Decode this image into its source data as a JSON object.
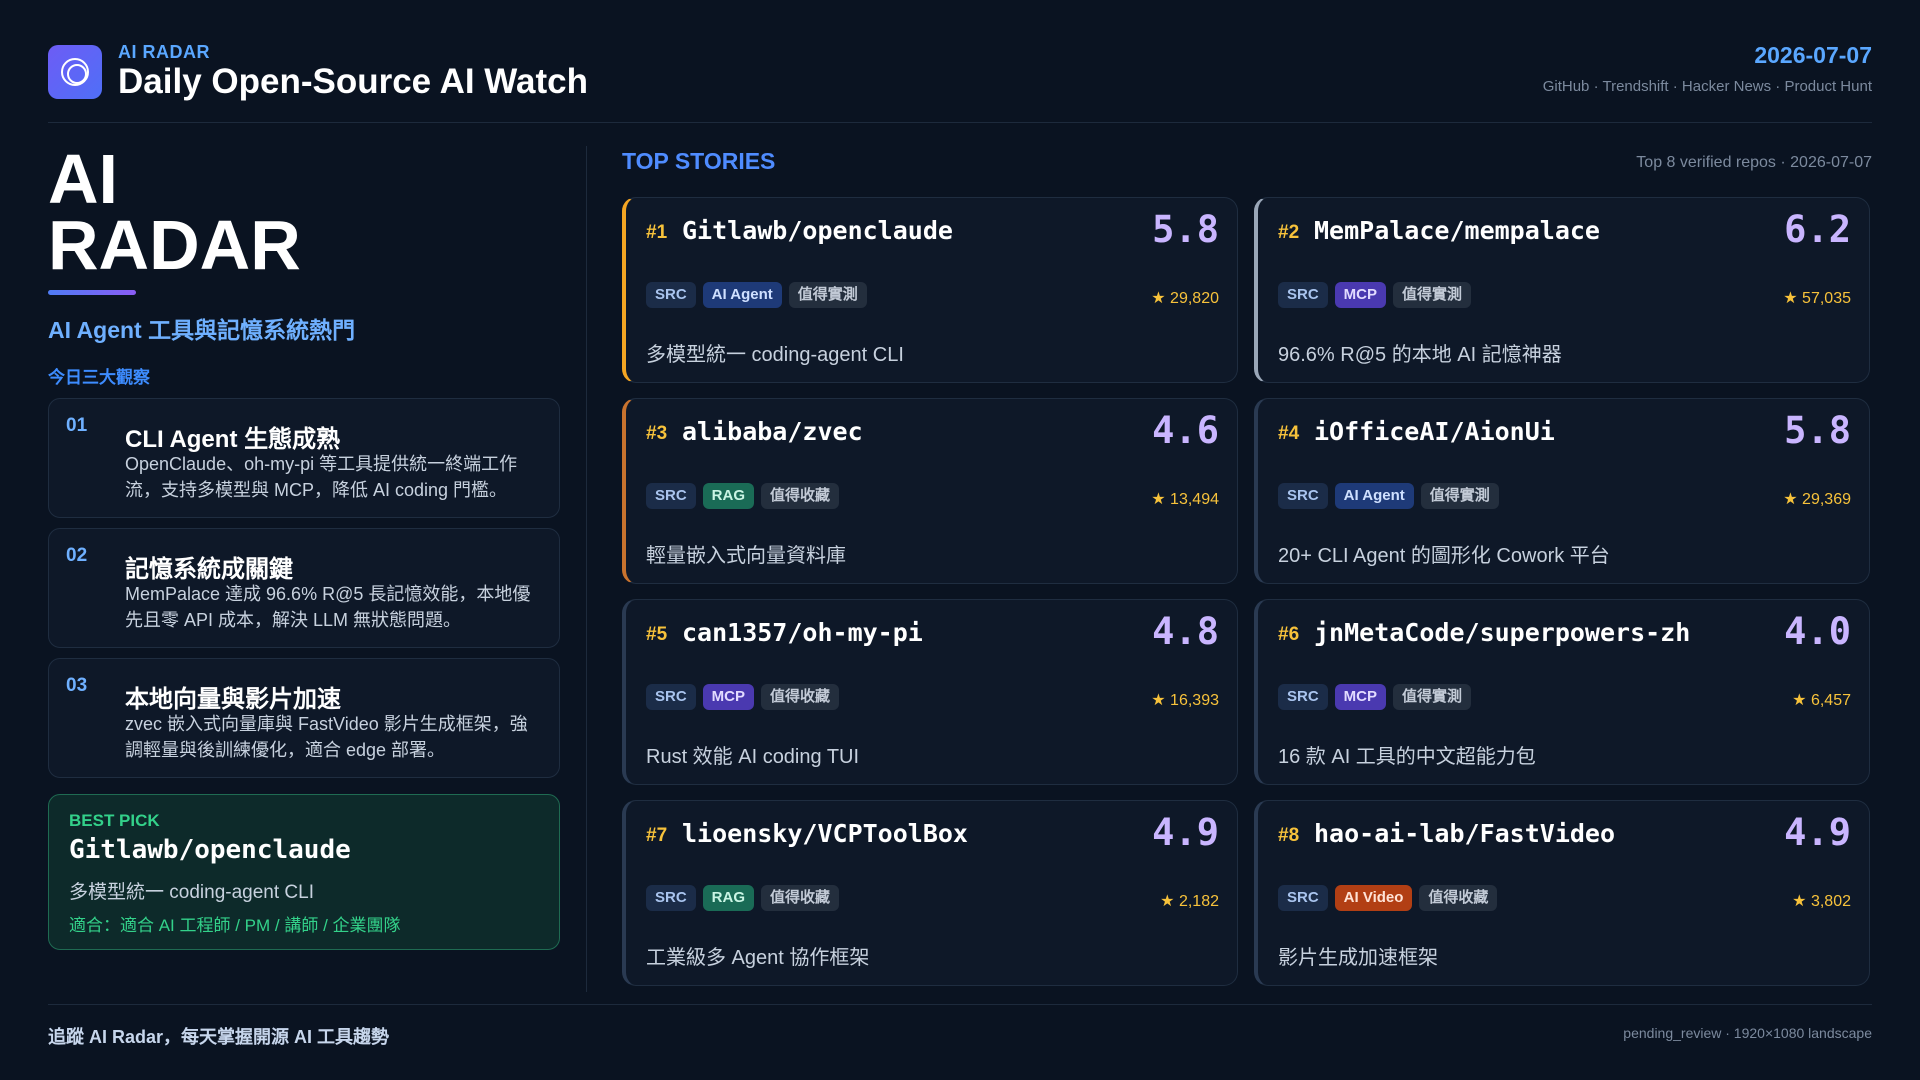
{
  "header": {
    "brand_small": "AI RADAR",
    "title": "Daily Open-Source AI Watch",
    "date": "2026-07-07",
    "sources": "GitHub · Trendshift · Hacker News · Product Hunt"
  },
  "hero": {
    "line1": "AI",
    "line2": "RADAR",
    "subtitle": "AI Agent 工具與記憶系統熱門",
    "insights_label": "今日三大觀察"
  },
  "insights": [
    {
      "num": "01",
      "title": "CLI Agent 生態成熟",
      "desc": "OpenClaude、oh-my-pi 等工具提供統一終端工作流，支持多模型與 MCP，降低 AI coding 門檻。"
    },
    {
      "num": "02",
      "title": "記憶系統成關鍵",
      "desc": "MemPalace 達成 96.6% R@5 長記憶效能，本地優先且零 API 成本，解決 LLM 無狀態問題。"
    },
    {
      "num": "03",
      "title": "本地向量與影片加速",
      "desc": "zvec 嵌入式向量庫與 FastVideo 影片生成框架，強調輕量與後訓練優化，適合 edge 部署。"
    }
  ],
  "best_pick": {
    "label": "BEST PICK",
    "name": "Gitlawb/openclaude",
    "desc": "多模型統一 coding-agent CLI",
    "fit": "適合：適合 AI 工程師 / PM / 講師 / 企業團隊"
  },
  "top_stories": {
    "title": "TOP STORIES",
    "meta": "Top 8 verified repos · 2026-07-07"
  },
  "stories": [
    {
      "rank": "#1",
      "name": "Gitlawb/openclaude",
      "score": "5.8",
      "tags": [
        "SRC",
        "AI Agent",
        "值得實測"
      ],
      "stars": "★ 29,820",
      "desc": "多模型統一 coding-agent CLI"
    },
    {
      "rank": "#2",
      "name": "MemPalace/mempalace",
      "score": "6.2",
      "tags": [
        "SRC",
        "MCP",
        "值得實測"
      ],
      "stars": "★ 57,035",
      "desc": "96.6% R@5 的本地 AI 記憶神器"
    },
    {
      "rank": "#3",
      "name": "alibaba/zvec",
      "score": "4.6",
      "tags": [
        "SRC",
        "RAG",
        "值得收藏"
      ],
      "stars": "★ 13,494",
      "desc": "輕量嵌入式向量資料庫"
    },
    {
      "rank": "#4",
      "name": "iOfficeAI/AionUi",
      "score": "5.8",
      "tags": [
        "SRC",
        "AI Agent",
        "值得實測"
      ],
      "stars": "★ 29,369",
      "desc": "20+ CLI Agent 的圖形化 Cowork 平台"
    },
    {
      "rank": "#5",
      "name": "can1357/oh-my-pi",
      "score": "4.8",
      "tags": [
        "SRC",
        "MCP",
        "值得收藏"
      ],
      "stars": "★ 16,393",
      "desc": "Rust 效能 AI coding TUI"
    },
    {
      "rank": "#6",
      "name": "jnMetaCode/superpowers-zh",
      "score": "4.0",
      "tags": [
        "SRC",
        "MCP",
        "值得實測"
      ],
      "stars": "★ 6,457",
      "desc": "16 款 AI 工具的中文超能力包"
    },
    {
      "rank": "#7",
      "name": "lioensky/VCPToolBox",
      "score": "4.9",
      "tags": [
        "SRC",
        "RAG",
        "值得收藏"
      ],
      "stars": "★ 2,182",
      "desc": "工業級多 Agent 協作框架"
    },
    {
      "rank": "#8",
      "name": "hao-ai-lab/FastVideo",
      "score": "4.9",
      "tags": [
        "SRC",
        "AI Video",
        "值得收藏"
      ],
      "stars": "★ 3,802",
      "desc": "影片生成加速框架"
    }
  ],
  "accent_colors": {
    "rank_1": "#f5a623",
    "rank_2": "#9aa7b8",
    "rank_3": "#c9732e"
  },
  "footer": {
    "left": "追蹤 AI Radar，每天掌握開源 AI 工具趨勢",
    "right": "pending_review · 1920×1080 landscape"
  }
}
